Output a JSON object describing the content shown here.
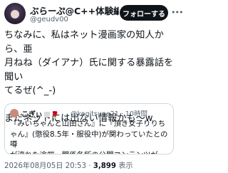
{
  "author": {
    "display_name": "ぶらーぷ@C++体験編進…",
    "handle": "@geudv00",
    "avatar_icon": "avatar-photo"
  },
  "header": {
    "follow_label": "フォローする",
    "more_icon": "more-horizontal-icon"
  },
  "tweet": {
    "text": "ちなみに、私はネット漫画家の知人から、亜\n月ねね（ダイアナ）氏に関する暴露話を聞い\nてるぜ(^_-)\n\nまだネットには出ない情報かも〜w"
  },
  "quote": {
    "display_name": "こぎぃ",
    "handle_time": "@kogitsune21 · 10時間",
    "text": "『みいちゃんと山田さん』に『頂き女子りりち\nゃん』(懲役8.5年・服役中)が関わっていたとの噂\nが流れた途端、関係各所の公開コンテンツが次々\n削除・非公開になってることと。"
  },
  "footer": {
    "timestamp": "2026年08月05日 20:53 · ",
    "views_count": "3,899",
    "views_label": " 表示"
  },
  "colors": {
    "text": "#0f1419",
    "secondary": "#536471",
    "border": "#cfd9de",
    "button_bg": "#0f1419"
  }
}
